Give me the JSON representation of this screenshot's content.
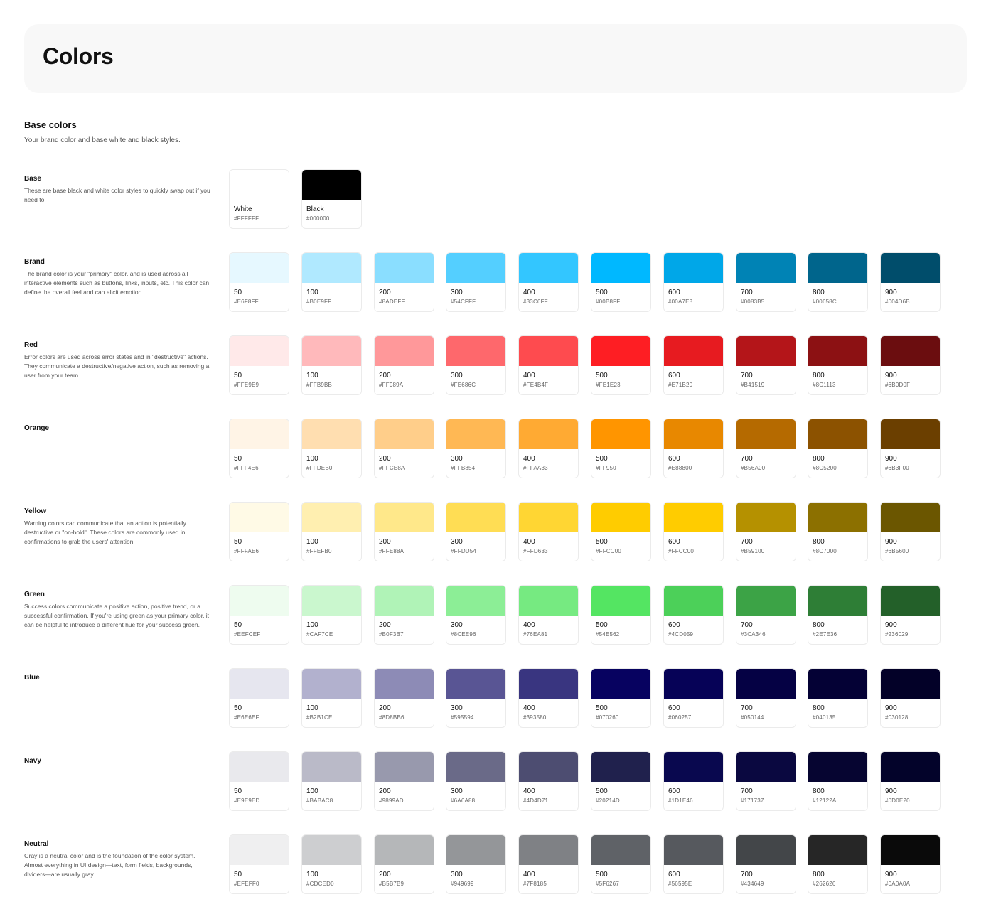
{
  "header": {
    "title": "Colors"
  },
  "section": {
    "title": "Base colors",
    "description": "Your brand color and base white and black styles."
  },
  "groups": [
    {
      "name": "Base",
      "description": "These are base black and white color styles to quickly swap out if you need to.",
      "swatches": [
        {
          "name": "White",
          "hex": "#FFFFFF"
        },
        {
          "name": "Black",
          "hex": "#000000"
        }
      ]
    },
    {
      "name": "Brand",
      "description": "The brand color is your \"primary\" color, and is used across all interactive elements such as buttons, links, inputs, etc. This color can define the overall feel and can elicit emotion.",
      "swatches": [
        {
          "name": "50",
          "hex": "#E6F8FF"
        },
        {
          "name": "100",
          "hex": "#B0E9FF"
        },
        {
          "name": "200",
          "hex": "#8ADEFF"
        },
        {
          "name": "300",
          "hex": "#54CFFF"
        },
        {
          "name": "400",
          "hex": "#33C6FF"
        },
        {
          "name": "500",
          "hex": "#00B8FF"
        },
        {
          "name": "600",
          "hex": "#00A7E8"
        },
        {
          "name": "700",
          "hex": "#0083B5"
        },
        {
          "name": "800",
          "hex": "#00658C"
        },
        {
          "name": "900",
          "hex": "#004D6B"
        }
      ]
    },
    {
      "name": "Red",
      "description": "Error colors are used across error states and in \"destructive\" actions. They communicate a destructive/negative action, such as removing a user from your team.",
      "swatches": [
        {
          "name": "50",
          "hex": "#FFE9E9"
        },
        {
          "name": "100",
          "hex": "#FFB9BB"
        },
        {
          "name": "200",
          "hex": "#FF989A"
        },
        {
          "name": "300",
          "hex": "#FE686C"
        },
        {
          "name": "400",
          "hex": "#FE4B4F"
        },
        {
          "name": "500",
          "hex": "#FE1E23"
        },
        {
          "name": "600",
          "hex": "#E71B20"
        },
        {
          "name": "700",
          "hex": "#B41519"
        },
        {
          "name": "800",
          "hex": "#8C1113"
        },
        {
          "name": "900",
          "hex": "#6B0D0F"
        }
      ]
    },
    {
      "name": "Orange",
      "description": "",
      "swatches": [
        {
          "name": "50",
          "hex": "#FFF4E6"
        },
        {
          "name": "100",
          "hex": "#FFDEB0"
        },
        {
          "name": "200",
          "hex": "#FFCE8A"
        },
        {
          "name": "300",
          "hex": "#FFB854"
        },
        {
          "name": "400",
          "hex": "#FFAA33"
        },
        {
          "name": "500",
          "hex": "#FF950"
        },
        {
          "name": "600",
          "hex": "#E88800"
        },
        {
          "name": "700",
          "hex": "#B56A00"
        },
        {
          "name": "800",
          "hex": "#8C5200"
        },
        {
          "name": "900",
          "hex": "#6B3F00"
        }
      ]
    },
    {
      "name": "Yellow",
      "description": "Warning colors can communicate that an action is potentially destructive or \"on-hold\". These colors are commonly used in confirmations to grab the users' attention.",
      "swatches": [
        {
          "name": "50",
          "hex": "#FFFAE6"
        },
        {
          "name": "100",
          "hex": "#FFEFB0"
        },
        {
          "name": "200",
          "hex": "#FFE88A"
        },
        {
          "name": "300",
          "hex": "#FFDD54"
        },
        {
          "name": "400",
          "hex": "#FFD633"
        },
        {
          "name": "500",
          "hex": "#FFCC00"
        },
        {
          "name": "600",
          "hex": "#FFCC00"
        },
        {
          "name": "700",
          "hex": "#B59100"
        },
        {
          "name": "800",
          "hex": "#8C7000"
        },
        {
          "name": "900",
          "hex": "#6B5600"
        }
      ]
    },
    {
      "name": "Green",
      "description": "Success colors communicate a positive action, positive trend, or a successful confirmation. If you're using green as your primary color, it can be helpful to introduce a different hue for your success green.",
      "swatches": [
        {
          "name": "50",
          "hex": "#EEFCEF"
        },
        {
          "name": "100",
          "hex": "#CAF7CE"
        },
        {
          "name": "200",
          "hex": "#B0F3B7"
        },
        {
          "name": "300",
          "hex": "#8CEE96"
        },
        {
          "name": "400",
          "hex": "#76EA81"
        },
        {
          "name": "500",
          "hex": "#54E562"
        },
        {
          "name": "600",
          "hex": "#4CD059"
        },
        {
          "name": "700",
          "hex": "#3CA346"
        },
        {
          "name": "800",
          "hex": "#2E7E36"
        },
        {
          "name": "900",
          "hex": "#236029"
        }
      ]
    },
    {
      "name": "Blue",
      "description": "",
      "swatches": [
        {
          "name": "50",
          "hex": "#E6E6EF"
        },
        {
          "name": "100",
          "hex": "#B2B1CE"
        },
        {
          "name": "200",
          "hex": "#8D8BB6"
        },
        {
          "name": "300",
          "hex": "#595594"
        },
        {
          "name": "400",
          "hex": "#393580"
        },
        {
          "name": "500",
          "hex": "#070260"
        },
        {
          "name": "600",
          "hex": "#060257"
        },
        {
          "name": "700",
          "hex": "#050144"
        },
        {
          "name": "800",
          "hex": "#040135"
        },
        {
          "name": "900",
          "hex": "#030128"
        }
      ]
    },
    {
      "name": "Navy",
      "description": "",
      "swatches": [
        {
          "name": "50",
          "hex": "#E9E9ED"
        },
        {
          "name": "100",
          "hex": "#BABAC8"
        },
        {
          "name": "200",
          "hex": "#9899AD"
        },
        {
          "name": "300",
          "hex": "#6A6A88"
        },
        {
          "name": "400",
          "hex": "#4D4D71"
        },
        {
          "name": "500",
          "hex": "#20214D"
        },
        {
          "name": "600",
          "hex": "#1D1E46"
        },
        {
          "name": "700",
          "hex": "#171737"
        },
        {
          "name": "800",
          "hex": "#12122A"
        },
        {
          "name": "900",
          "hex": "#0D0E20"
        }
      ]
    },
    {
      "name": "Neutral",
      "description": "Gray is a neutral color and is the foundation of the color system. Almost everything in UI design—text, form fields, backgrounds, dividers—are usually gray.",
      "swatches": [
        {
          "name": "50",
          "hex": "#EFEFF0"
        },
        {
          "name": "100",
          "hex": "#CDCED0"
        },
        {
          "name": "200",
          "hex": "#B5B7B9"
        },
        {
          "name": "300",
          "hex": "#949699"
        },
        {
          "name": "400",
          "hex": "#7F8185"
        },
        {
          "name": "500",
          "hex": "#5F6267"
        },
        {
          "name": "600",
          "hex": "#56595E"
        },
        {
          "name": "700",
          "hex": "#434649"
        },
        {
          "name": "800",
          "hex": "#262626"
        },
        {
          "name": "900",
          "hex": "#0A0A0A"
        }
      ]
    }
  ],
  "swatch_fills": {
    "Blue": [
      "#E6E6EF",
      "#B2B1CE",
      "#8D8BB6",
      "#595594",
      "#393580",
      "#070260",
      "#060257",
      "#050144",
      "#040135",
      "#030128"
    ],
    "Navy": [
      "#E9E9ED",
      "#BABAC8",
      "#9899AD",
      "#6A6A88",
      "#4D4D71",
      "#20214D",
      "#09084F",
      "#0A0840",
      "#060531",
      "#03032A"
    ],
    "Orange_500": "#FF9500",
    "Red_500": "#FE1E23",
    "Red_600": "#E71B20"
  }
}
